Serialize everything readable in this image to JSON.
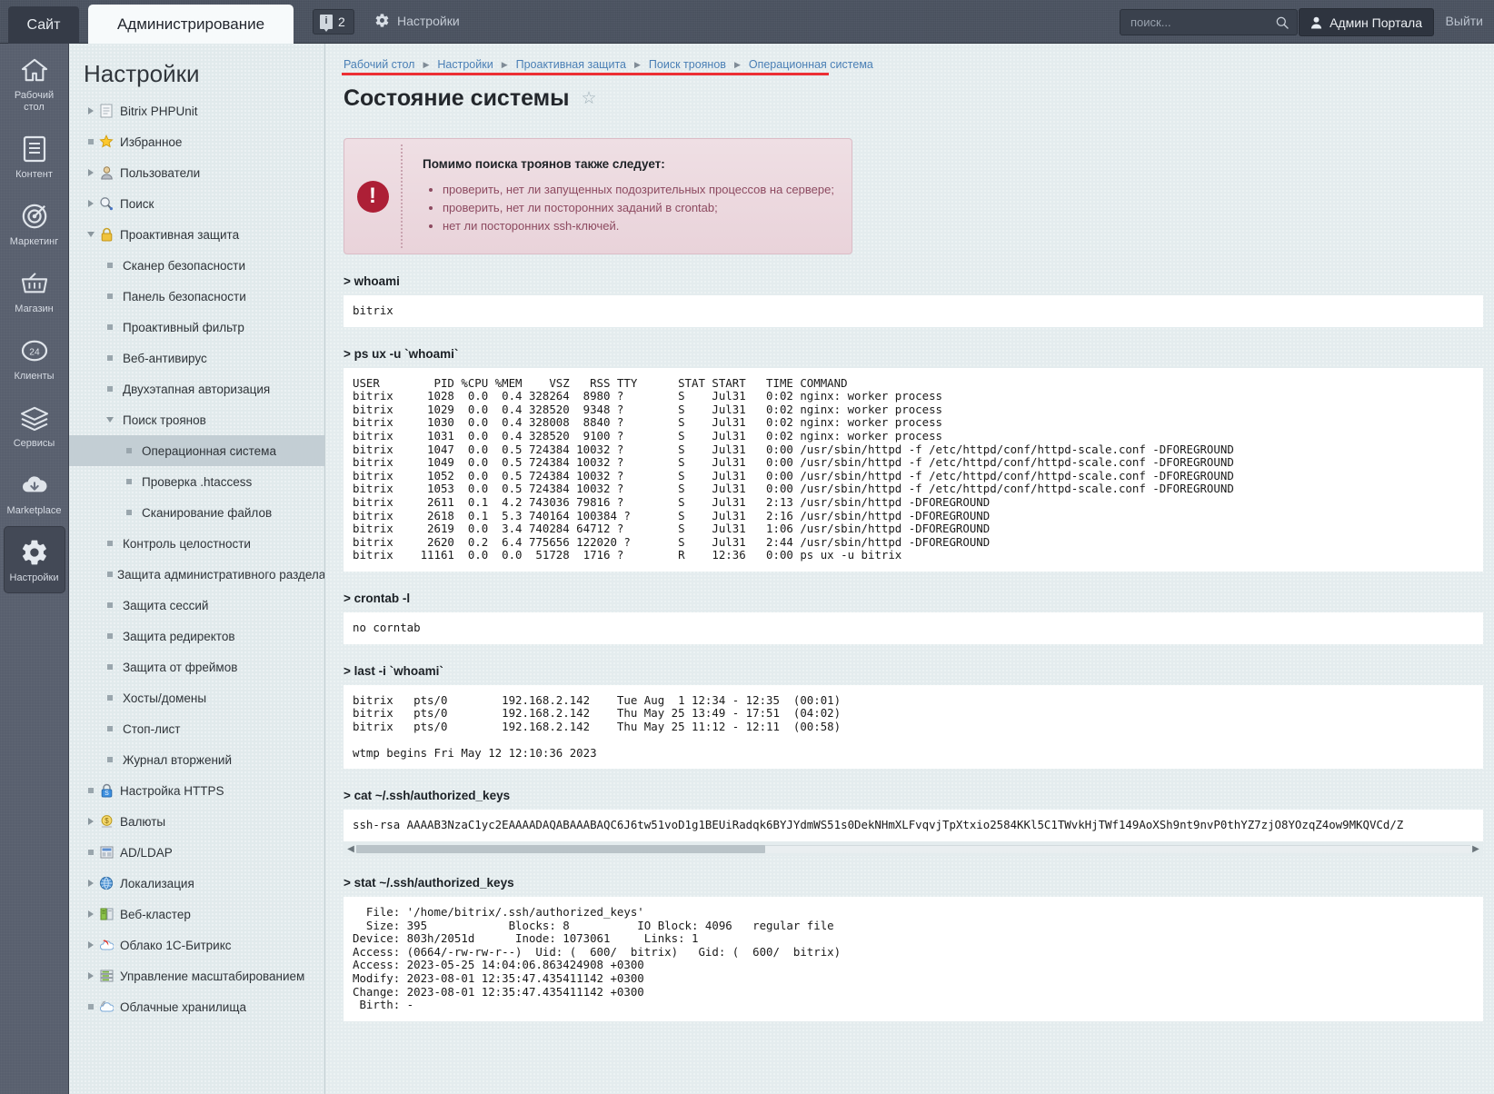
{
  "topbar": {
    "tab_site": "Сайт",
    "tab_admin": "Администрирование",
    "notifications_count": "2",
    "notifications_icon": "info-badge-icon",
    "settings_label": "Настройки",
    "search_placeholder": "поиск...",
    "search_value": "",
    "user_label": "Админ Портала",
    "logout_label": "Выйти"
  },
  "rail": [
    {
      "label": "Рабочий\nстол",
      "icon": "home-icon",
      "active": false
    },
    {
      "label": "Контент",
      "icon": "document-icon",
      "active": false
    },
    {
      "label": "Маркетинг",
      "icon": "target-icon",
      "active": false
    },
    {
      "label": "Магазин",
      "icon": "basket-icon",
      "active": false
    },
    {
      "label": "Клиенты",
      "icon": "clients-24-icon",
      "active": false
    },
    {
      "label": "Сервисы",
      "icon": "layers-icon",
      "active": false
    },
    {
      "label": "Marketplace",
      "icon": "cloud-download-icon",
      "active": false
    },
    {
      "label": "Настройки",
      "icon": "gear-icon",
      "active": true
    }
  ],
  "tree": {
    "title": "Настройки",
    "items": [
      {
        "label": "Bitrix PHPUnit",
        "level": 1,
        "twisty": "right",
        "icon": "page-icon",
        "selected": false
      },
      {
        "label": "Избранное",
        "level": 1,
        "twisty": "dot",
        "icon": "star-icon",
        "selected": false
      },
      {
        "label": "Пользователи",
        "level": 1,
        "twisty": "right",
        "icon": "user-icon",
        "selected": false
      },
      {
        "label": "Поиск",
        "level": 1,
        "twisty": "right",
        "icon": "magnifier-icon",
        "selected": false
      },
      {
        "label": "Проактивная защита",
        "level": 1,
        "twisty": "down",
        "icon": "lock-icon",
        "selected": false
      },
      {
        "label": "Сканер безопасности",
        "level": 2,
        "twisty": "dot",
        "icon": "",
        "selected": false
      },
      {
        "label": "Панель безопасности",
        "level": 2,
        "twisty": "dot",
        "icon": "",
        "selected": false
      },
      {
        "label": "Проактивный фильтр",
        "level": 2,
        "twisty": "dot",
        "icon": "",
        "selected": false
      },
      {
        "label": "Веб-антивирус",
        "level": 2,
        "twisty": "dot",
        "icon": "",
        "selected": false
      },
      {
        "label": "Двухэтапная авторизация",
        "level": 2,
        "twisty": "dot",
        "icon": "",
        "selected": false
      },
      {
        "label": "Поиск троянов",
        "level": 2,
        "twisty": "down",
        "icon": "",
        "selected": false
      },
      {
        "label": "Операционная система",
        "level": 3,
        "twisty": "dot",
        "icon": "",
        "selected": true
      },
      {
        "label": "Проверка .htaccess",
        "level": 3,
        "twisty": "dot",
        "icon": "",
        "selected": false
      },
      {
        "label": "Сканирование файлов",
        "level": 3,
        "twisty": "dot",
        "icon": "",
        "selected": false
      },
      {
        "label": "Контроль целостности",
        "level": 2,
        "twisty": "dot",
        "icon": "",
        "selected": false
      },
      {
        "label": "Защита административного раздела",
        "level": 2,
        "twisty": "dot",
        "icon": "",
        "selected": false
      },
      {
        "label": "Защита сессий",
        "level": 2,
        "twisty": "dot",
        "icon": "",
        "selected": false
      },
      {
        "label": "Защита редиректов",
        "level": 2,
        "twisty": "dot",
        "icon": "",
        "selected": false
      },
      {
        "label": "Защита от фреймов",
        "level": 2,
        "twisty": "dot",
        "icon": "",
        "selected": false
      },
      {
        "label": "Хосты/домены",
        "level": 2,
        "twisty": "dot",
        "icon": "",
        "selected": false
      },
      {
        "label": "Стоп-лист",
        "level": 2,
        "twisty": "dot",
        "icon": "",
        "selected": false
      },
      {
        "label": "Журнал вторжений",
        "level": 2,
        "twisty": "dot",
        "icon": "",
        "selected": false
      },
      {
        "label": "Настройка HTTPS",
        "level": 1,
        "twisty": "dot",
        "icon": "https-lock-icon",
        "selected": false
      },
      {
        "label": "Валюты",
        "level": 1,
        "twisty": "right",
        "icon": "currency-icon",
        "selected": false
      },
      {
        "label": "AD/LDAP",
        "level": 1,
        "twisty": "dot",
        "icon": "ldap-icon",
        "selected": false
      },
      {
        "label": "Локализация",
        "level": 1,
        "twisty": "right",
        "icon": "globe-icon",
        "selected": false
      },
      {
        "label": "Веб-кластер",
        "level": 1,
        "twisty": "right",
        "icon": "servers-icon",
        "selected": false
      },
      {
        "label": "Облако 1С-Битрикс",
        "level": 1,
        "twisty": "right",
        "icon": "cloud-bitrix-icon",
        "selected": false
      },
      {
        "label": "Управление масштабированием",
        "level": 1,
        "twisty": "right",
        "icon": "scaling-icon",
        "selected": false
      },
      {
        "label": "Облачные хранилища",
        "level": 1,
        "twisty": "dot",
        "icon": "cloud-storage-icon",
        "selected": false
      }
    ]
  },
  "breadcrumbs": [
    "Рабочий стол",
    "Настройки",
    "Проактивная защита",
    "Поиск троянов",
    "Операционная система"
  ],
  "page": {
    "title": "Состояние системы",
    "favorite_icon": "star-outline-icon"
  },
  "alert": {
    "icon": "exclamation-icon",
    "title": "Помимо поиска троянов также следует:",
    "items": [
      "проверить, нет ли запущенных подозрительных процессов на сервере;",
      "проверить, нет ли посторонних заданий в crontab;",
      "нет ли посторонних ssh-ключей."
    ]
  },
  "sections": [
    {
      "command": "> whoami",
      "output": "bitrix"
    },
    {
      "command": "> ps ux -u `whoami`",
      "output": "USER        PID %CPU %MEM    VSZ   RSS TTY      STAT START   TIME COMMAND\nbitrix     1028  0.0  0.4 328264  8980 ?        S    Jul31   0:02 nginx: worker process\nbitrix     1029  0.0  0.4 328520  9348 ?        S    Jul31   0:02 nginx: worker process\nbitrix     1030  0.0  0.4 328008  8840 ?        S    Jul31   0:02 nginx: worker process\nbitrix     1031  0.0  0.4 328520  9100 ?        S    Jul31   0:02 nginx: worker process\nbitrix     1047  0.0  0.5 724384 10032 ?        S    Jul31   0:00 /usr/sbin/httpd -f /etc/httpd/conf/httpd-scale.conf -DFOREGROUND\nbitrix     1049  0.0  0.5 724384 10032 ?        S    Jul31   0:00 /usr/sbin/httpd -f /etc/httpd/conf/httpd-scale.conf -DFOREGROUND\nbitrix     1052  0.0  0.5 724384 10032 ?        S    Jul31   0:00 /usr/sbin/httpd -f /etc/httpd/conf/httpd-scale.conf -DFOREGROUND\nbitrix     1053  0.0  0.5 724384 10032 ?        S    Jul31   0:00 /usr/sbin/httpd -f /etc/httpd/conf/httpd-scale.conf -DFOREGROUND\nbitrix     2611  0.1  4.2 743036 79816 ?        S    Jul31   2:13 /usr/sbin/httpd -DFOREGROUND\nbitrix     2618  0.1  5.3 740164 100384 ?       S    Jul31   2:16 /usr/sbin/httpd -DFOREGROUND\nbitrix     2619  0.0  3.4 740284 64712 ?        S    Jul31   1:06 /usr/sbin/httpd -DFOREGROUND\nbitrix     2620  0.2  6.4 775656 122020 ?       S    Jul31   2:44 /usr/sbin/httpd -DFOREGROUND\nbitrix    11161  0.0  0.0  51728  1716 ?        R    12:36   0:00 ps ux -u bitrix"
    },
    {
      "command": "> crontab -l",
      "output": "no corntab"
    },
    {
      "command": "> last -i `whoami`",
      "output": "bitrix   pts/0        192.168.2.142    Tue Aug  1 12:34 - 12:35  (00:01)\nbitrix   pts/0        192.168.2.142    Thu May 25 13:49 - 17:51  (04:02)\nbitrix   pts/0        192.168.2.142    Thu May 25 11:12 - 12:11  (00:58)\n\nwtmp begins Fri May 12 12:10:36 2023"
    },
    {
      "command": "> cat ~/.ssh/authorized_keys",
      "output": "ssh-rsa AAAAB3NzaC1yc2EAAAADAQABAAABAQC6J6tw51voD1g1BEUiRadqk6BYJYdmWS51s0DekNHmXLFvqvjTpXtxio2584KKl5C1TWvkHjTWf149AoXSh9nt9nvP0thYZ7zjO8YOzqZ4ow9MKQVCd/Z",
      "scrollbar": true
    },
    {
      "command": "> stat ~/.ssh/authorized_keys",
      "output": "  File: '/home/bitrix/.ssh/authorized_keys'\n  Size: 395            Blocks: 8          IO Block: 4096   regular file\nDevice: 803h/2051d      Inode: 1073061     Links: 1\nAccess: (0664/-rw-rw-r--)  Uid: (  600/  bitrix)   Gid: (  600/  bitrix)\nAccess: 2023-05-25 14:04:06.863424908 +0300\nModify: 2023-08-01 12:35:47.435411142 +0300\nChange: 2023-08-01 12:35:47.435411142 +0300\n Birth: -"
    }
  ],
  "colors": {
    "accent_red": "#ec2f34",
    "link_blue": "#4a7fb5",
    "alert_bg": "#e9d3da",
    "alert_icon": "#ad1f36"
  }
}
